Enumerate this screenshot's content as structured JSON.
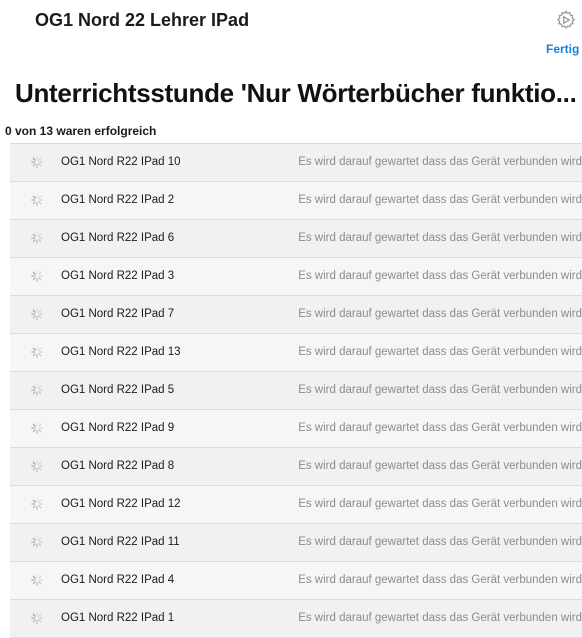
{
  "header": {
    "device_title": "OG1 Nord 22 Lehrer IPad",
    "done_label": "Fertig",
    "settings_icon": "gear-icon"
  },
  "lesson": {
    "title": "Unterrichtsstunde 'Nur Wörterbücher funktio...",
    "summary": "0 von 13 waren erfolgreich"
  },
  "devices": [
    {
      "name": "OG1 Nord R22 IPad 10",
      "status": "Es wird darauf gewartet dass das Gerät verbunden wird"
    },
    {
      "name": "OG1 Nord R22 IPad 2",
      "status": "Es wird darauf gewartet dass das Gerät verbunden wird"
    },
    {
      "name": "OG1 Nord R22 IPad 6",
      "status": "Es wird darauf gewartet dass das Gerät verbunden wird"
    },
    {
      "name": "OG1 Nord R22 IPad 3",
      "status": "Es wird darauf gewartet dass das Gerät verbunden wird"
    },
    {
      "name": "OG1 Nord R22 IPad 7",
      "status": "Es wird darauf gewartet dass das Gerät verbunden wird"
    },
    {
      "name": "OG1 Nord R22 IPad 13",
      "status": "Es wird darauf gewartet dass das Gerät verbunden wird"
    },
    {
      "name": "OG1 Nord R22 IPad 5",
      "status": "Es wird darauf gewartet dass das Gerät verbunden wird"
    },
    {
      "name": "OG1 Nord R22 IPad 9",
      "status": "Es wird darauf gewartet dass das Gerät verbunden wird"
    },
    {
      "name": "OG1 Nord R22 IPad 8",
      "status": "Es wird darauf gewartet dass das Gerät verbunden wird"
    },
    {
      "name": "OG1 Nord R22 IPad 12",
      "status": "Es wird darauf gewartet dass das Gerät verbunden wird"
    },
    {
      "name": "OG1 Nord R22 IPad 11",
      "status": "Es wird darauf gewartet dass das Gerät verbunden wird"
    },
    {
      "name": "OG1 Nord R22 IPad 4",
      "status": "Es wird darauf gewartet dass das Gerät verbunden wird"
    },
    {
      "name": "OG1 Nord R22 IPad 1",
      "status": "Es wird darauf gewartet dass das Gerät verbunden wird"
    }
  ],
  "colors": {
    "accent": "#1a7fe0",
    "status_text": "#8c8c8c",
    "row_background": "#f6f6f6"
  }
}
